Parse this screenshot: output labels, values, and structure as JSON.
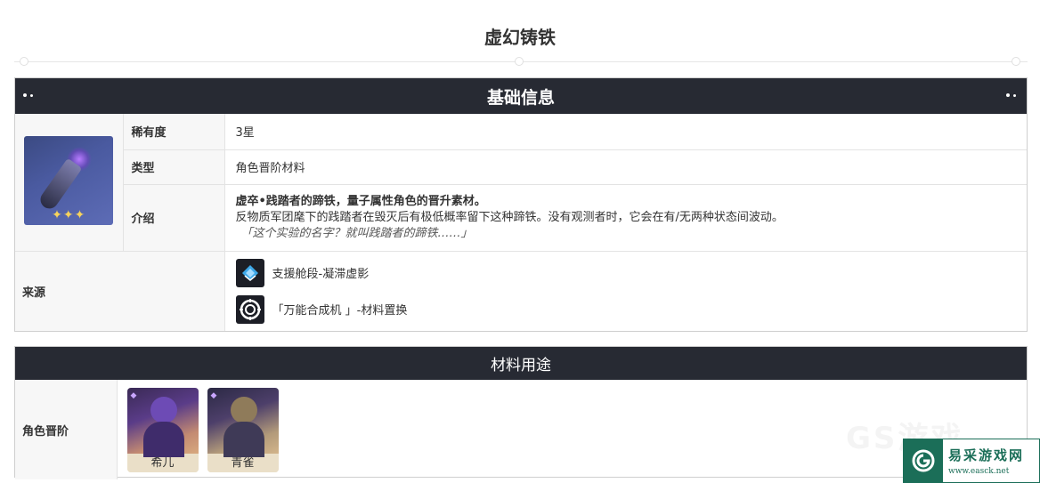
{
  "page": {
    "title": "虚幻铸铁"
  },
  "basic_info": {
    "header": "基础信息",
    "rows": {
      "rarity": {
        "label": "稀有度",
        "value": "3星"
      },
      "type": {
        "label": "类型",
        "value": "角色晋阶材料"
      },
      "intro": {
        "label": "介绍",
        "bold": "虚卒•践踏者的蹄铁，量子属性角色的晋升素材。",
        "line": "反物质军团麾下的践踏者在毁灭后有极低概率留下这种蹄铁。没有观测者时，它会在有/无两种状态间波动。",
        "quote": "「这个实验的名字？就叫践踏者的蹄铁……」"
      }
    },
    "item_icon": "horseshoe-shard-icon",
    "item_stars": "✦✦✦",
    "source": {
      "label": "来源",
      "items": [
        {
          "icon": "support-stage-icon",
          "text": "支援舱段-凝滞虚影"
        },
        {
          "icon": "synthesizer-icon",
          "text": "「万能合成机 」-材料置换"
        }
      ]
    }
  },
  "usage": {
    "header": "材料用途",
    "label": "角色晋阶",
    "characters": [
      {
        "name": "希儿"
      },
      {
        "name": "青雀"
      }
    ]
  },
  "watermark": {
    "cn": "易采游戏网",
    "url": "www.easck.net",
    "faded": "GS游戏"
  },
  "colors": {
    "header_bg": "#272a33",
    "label_bg": "#f7f7f7",
    "watermark_green": "#1b6e58"
  }
}
